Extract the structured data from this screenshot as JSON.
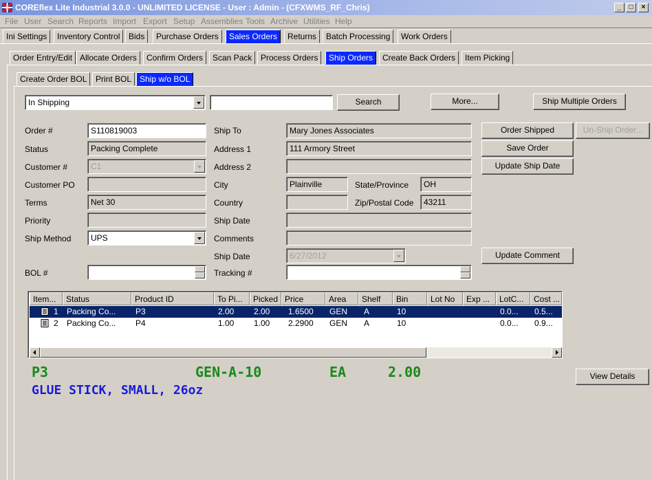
{
  "window": {
    "title": "COREflex Lite Industrial 3.0.0 - UNLIMITED LICENSE - User : Admin - (CFXWMS_RF_Chris)",
    "minimize": "_",
    "maximize": "□",
    "close": "×"
  },
  "menu": [
    "File",
    "User",
    "Search",
    "Reports",
    "Import",
    "Export",
    "Setup",
    "Assemblies",
    "Tools",
    "Archive",
    "Utilities",
    "Help"
  ],
  "main_tabs": [
    "Ini Settings",
    "Inventory Control",
    "Bids",
    "Purchase Orders",
    "Sales Orders",
    "Returns",
    "Batch Processing",
    "Work Orders"
  ],
  "sub_tabs": [
    "Order Entry/Edit",
    "Allocate Orders",
    "Confirm Orders",
    "Scan Pack",
    "Process Orders",
    "Ship Orders",
    "Create Back Orders",
    "Item Picking"
  ],
  "ship_tabs": [
    "Create Order BOL",
    "Print BOL",
    "Ship w/o BOL"
  ],
  "filter": {
    "status_value": "In Shipping",
    "search_text": ""
  },
  "buttons": {
    "search": "Search",
    "more": "More...",
    "ship_multiple": "Ship Multiple Orders",
    "order_shipped": "Order Shipped",
    "unship": "Un-Ship Order...",
    "save_order": "Save Order",
    "update_ship_date": "Update Ship Date",
    "update_comment": "Update Comment",
    "view_details": "View Details"
  },
  "labels": {
    "order": "Order #",
    "status": "Status",
    "customer": "Customer #",
    "customer_po": "Customer PO",
    "terms": "Terms",
    "priority": "Priority",
    "ship_method": "Ship Method",
    "bol": "BOL #",
    "ship_to": "Ship To",
    "address1": "Address 1",
    "address2": "Address 2",
    "city": "City",
    "country": "Country",
    "ship_date": "Ship Date",
    "comments": "Comments",
    "ship_date2": "Ship Date",
    "tracking": "Tracking #",
    "state": "State/Province",
    "zip": "Zip/Postal Code"
  },
  "values": {
    "order": "S110819003",
    "status": "Packing Complete",
    "customer": "C1",
    "customer_po": "",
    "terms": "Net 30",
    "priority": "",
    "ship_method": "UPS",
    "bol": "",
    "ship_to": "Mary Jones Associates",
    "address1": "111 Armory Street",
    "address2": "",
    "city": "Plainville",
    "country": "",
    "ship_date": "",
    "comments": "",
    "ship_date2": "6/27/2012",
    "tracking": "",
    "state": "OH",
    "zip": "43211"
  },
  "grid": {
    "columns": [
      "Item...",
      "Status",
      "Product ID",
      "To Pi...",
      "Picked",
      "Price",
      "Area",
      "Shelf",
      "Bin",
      "Lot No",
      "Exp ...",
      "LotC...",
      "Cost ..."
    ],
    "rows": [
      {
        "item": "1",
        "status": "Packing Co...",
        "product": "P3",
        "topick": "2.00",
        "picked": "2.00",
        "price": "1.6500",
        "area": "GEN",
        "shelf": "A",
        "bin": "10",
        "lot": "",
        "exp": "",
        "lotc": "0.0...",
        "cost": "0.5..."
      },
      {
        "item": "2",
        "status": "Packing Co...",
        "product": "P4",
        "topick": "1.00",
        "picked": "1.00",
        "price": "2.2900",
        "area": "GEN",
        "shelf": "A",
        "bin": "10",
        "lot": "",
        "exp": "",
        "lotc": "0.0...",
        "cost": "0.9..."
      }
    ]
  },
  "detail": {
    "product": "P3",
    "location": "GEN-A-10",
    "uom": "EA",
    "qty": "2.00",
    "description": "GLUE STICK, SMALL, 26oz",
    "colors": {
      "green": "#1a8a1a",
      "blue": "#1a1adc"
    }
  }
}
